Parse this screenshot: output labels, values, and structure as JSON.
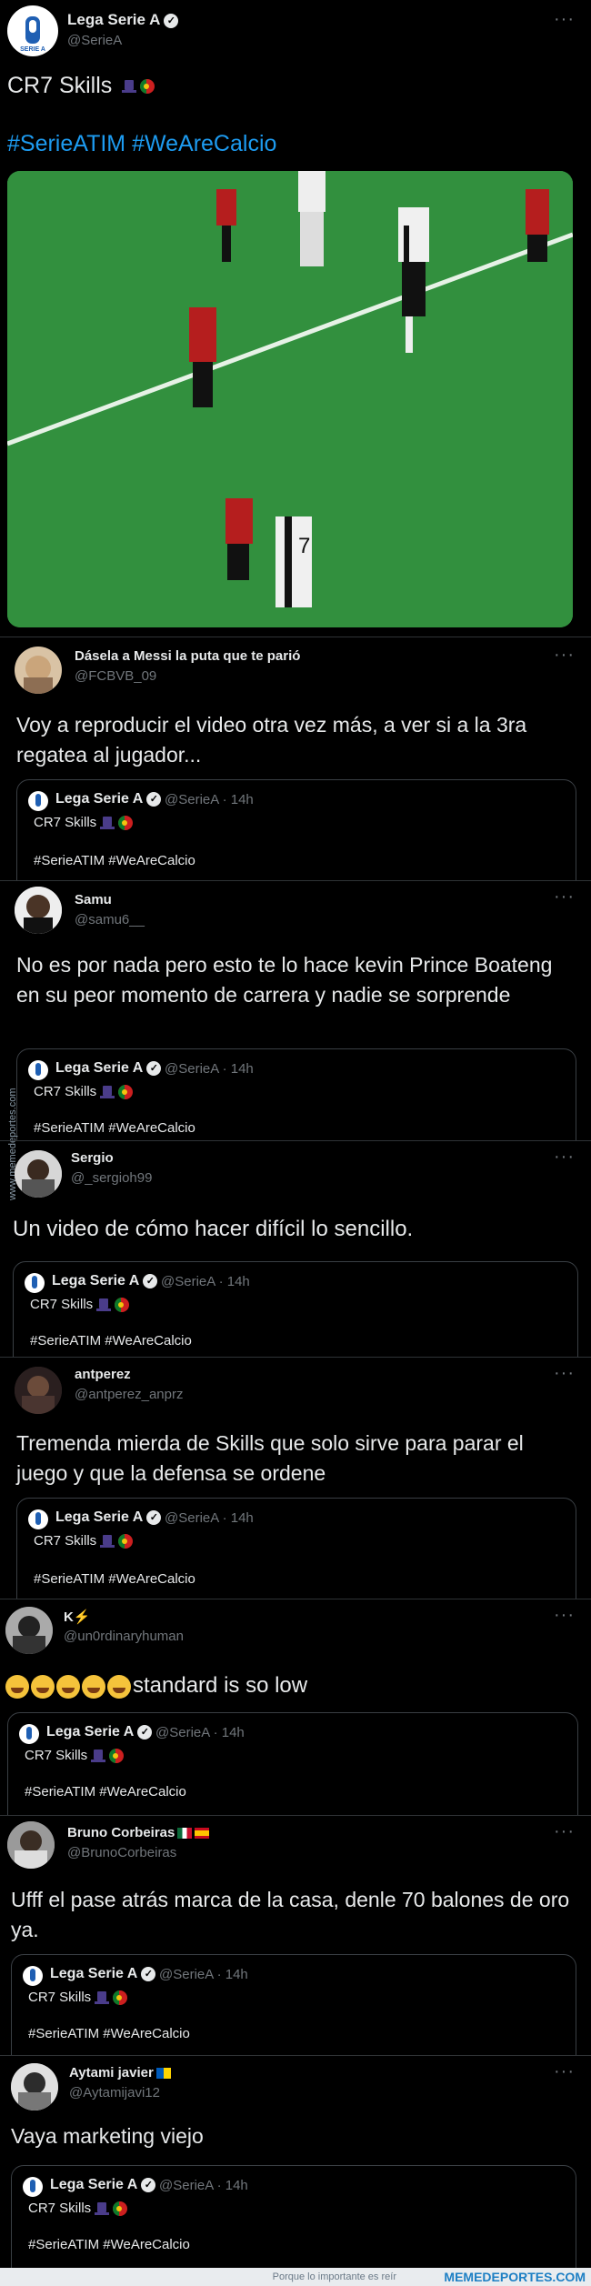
{
  "main": {
    "author": "Lega Serie A",
    "handle": "@SerieA",
    "text": "CR7 Skills",
    "hashtags": "#SerieATIM #WeAreCalcio"
  },
  "quoted": {
    "author": "Lega Serie A",
    "meta": "@SerieA · 14h",
    "text": "CR7 Skills",
    "hashtags": "#SerieATIM #WeAreCalcio"
  },
  "replies": [
    {
      "name": "Dásela a Messi la puta que te parió",
      "handle": "@FCBVB_09",
      "text": "Voy a reproducir el video otra vez más, a ver si a la 3ra regatea al jugador..."
    },
    {
      "name": "Samu",
      "handle": "@samu6__",
      "text": "No es por nada pero esto te lo hace kevin Prince Boateng en su peor momento de carrera y nadie se sorprende"
    },
    {
      "name": "Sergio",
      "handle": "@_sergioh99",
      "text": "Un video de cómo hacer difícil lo sencillo."
    },
    {
      "name": "antperez",
      "handle": "@antperez_anprz",
      "text": "Tremenda mierda de Skills que solo sirve para parar el juego y que la defensa se ordene"
    },
    {
      "name": "K⚡",
      "handle": "@un0rdinaryhuman",
      "text": "standard is so low"
    },
    {
      "name": "Bruno Corbeiras",
      "handle": "@BrunoCorbeiras",
      "text": "Ufff el pase atrás marca de la casa, denle 70 balones de oro ya."
    },
    {
      "name": "Aytami javier",
      "handle": "@Aytamijavi12",
      "text": "Vaya marketing viejo"
    }
  ],
  "ui": {
    "more": "···",
    "verified": "✓"
  },
  "watermark": "www.memedeportes.com",
  "footer": {
    "tagline": "Porque lo importante es reír",
    "brand": "MEMEDEPORTES.COM"
  },
  "icons": [
    "serie-a-logo-icon",
    "verified-icon",
    "top-hat-icon",
    "portugal-flag-icon",
    "more-icon",
    "rolling-laughing-icon",
    "mexico-flag-icon",
    "spain-flag-icon",
    "ukraine-flag-icon"
  ],
  "colors": {
    "background": "#000000",
    "text": "#e7e9ea",
    "muted": "#71767b",
    "link": "#1d9bf0",
    "border": "#2f3336"
  }
}
